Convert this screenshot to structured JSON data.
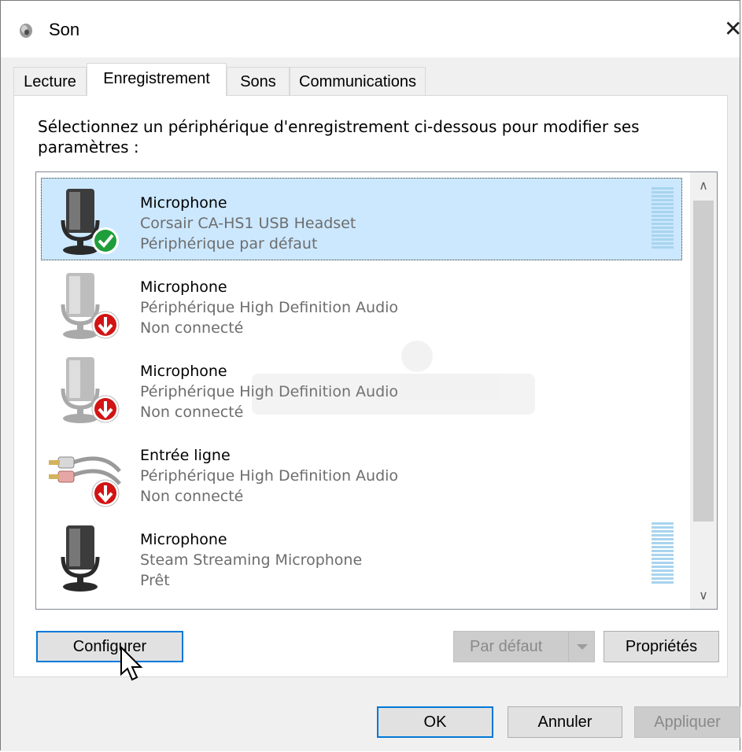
{
  "window": {
    "title": "Son",
    "close_glyph": "✕"
  },
  "tabs": [
    {
      "label": "Lecture",
      "active": false
    },
    {
      "label": "Enregistrement",
      "active": true
    },
    {
      "label": "Sons",
      "active": false
    },
    {
      "label": "Communications",
      "active": false
    }
  ],
  "instruction": "Sélectionnez un périphérique d'enregistrement ci-dessous pour modifier ses paramètres :",
  "devices": [
    {
      "name": "Microphone",
      "description": "Corsair CA-HS1 USB Headset",
      "status": "Périphérique par défaut",
      "icon": "microphone-default-icon",
      "selected": true
    },
    {
      "name": "Microphone",
      "description": "Périphérique High Definition Audio",
      "status": "Non connecté",
      "icon": "microphone-disconnected-icon",
      "selected": false
    },
    {
      "name": "Microphone",
      "description": "Périphérique High Definition Audio",
      "status": "Non connecté",
      "icon": "microphone-disconnected-icon",
      "selected": false
    },
    {
      "name": "Entrée ligne",
      "description": "Périphérique High Definition Audio",
      "status": "Non connecté",
      "icon": "line-in-disconnected-icon",
      "selected": false
    },
    {
      "name": "Microphone",
      "description": "Steam Streaming Microphone",
      "status": "Prêt",
      "icon": "microphone-icon",
      "selected": false
    }
  ],
  "buttons": {
    "configure": "Configurer",
    "default": "Par défaut",
    "properties": "Propriétés",
    "ok": "OK",
    "cancel": "Annuler",
    "apply": "Appliquer"
  },
  "colors": {
    "selection": "#cce8ff",
    "focus_border": "#0078d7",
    "default_badge": "#1e9e3a",
    "disconnected_badge": "#d21414"
  }
}
